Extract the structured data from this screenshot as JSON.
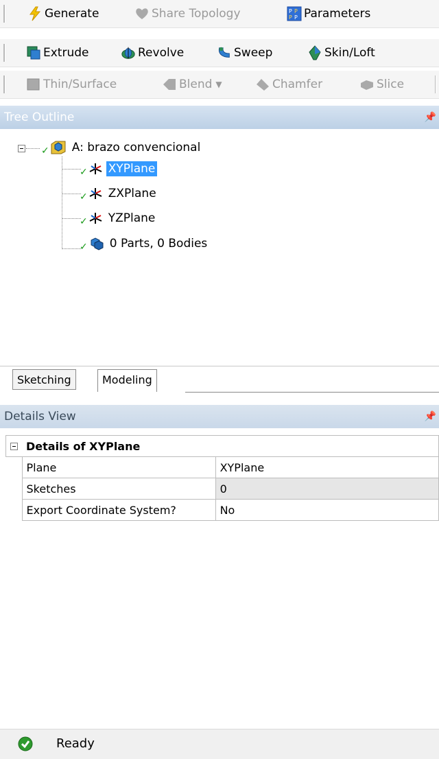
{
  "toolbar1": {
    "generate": "Generate",
    "share_topology": "Share Topology",
    "parameters": "Parameters"
  },
  "toolbar2": {
    "extrude": "Extrude",
    "revolve": "Revolve",
    "sweep": "Sweep",
    "skin_loft": "Skin/Loft"
  },
  "toolbar3": {
    "thin_surface": "Thin/Surface",
    "blend": "Blend",
    "chamfer": "Chamfer",
    "slice": "Slice"
  },
  "tree": {
    "title": "Tree Outline",
    "root": "A: brazo convencional",
    "items": [
      "XYPlane",
      "ZXPlane",
      "YZPlane",
      "0 Parts, 0 Bodies"
    ]
  },
  "tabs": [
    "Sketching",
    "Modeling"
  ],
  "details": {
    "title": "Details View",
    "group": "Details of XYPlane",
    "rows": [
      {
        "label": "Plane",
        "value": "XYPlane"
      },
      {
        "label": "Sketches",
        "value": "0"
      },
      {
        "label": "Export Coordinate System?",
        "value": "No"
      }
    ]
  },
  "status": {
    "text": "Ready"
  },
  "colors": {
    "accent": "#3399ff",
    "header_top": "#d6e3f1",
    "header_bottom": "#bcd0e6",
    "ok_green": "#2e9a2e"
  }
}
